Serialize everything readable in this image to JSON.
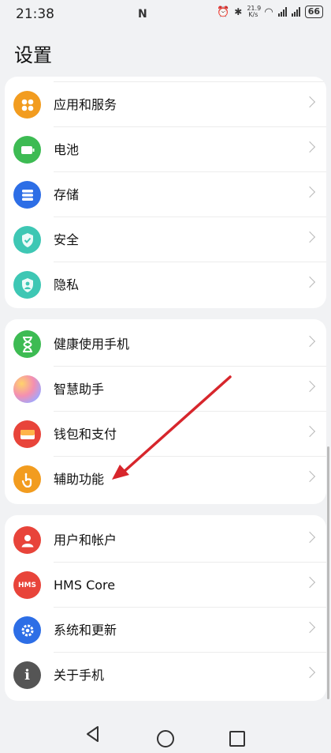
{
  "status_bar": {
    "time": "21:38",
    "nfc": "N",
    "speed_value": "21.9",
    "speed_unit": "K/s",
    "battery": "66"
  },
  "page_title": "设置",
  "group1": [
    {
      "label": "应用和服务",
      "icon": "apps-icon",
      "color": "#f29c1f"
    },
    {
      "label": "电池",
      "icon": "battery-icon",
      "color": "#3dbb53"
    },
    {
      "label": "存储",
      "icon": "storage-icon",
      "color": "#2d6ee6"
    },
    {
      "label": "安全",
      "icon": "shield-icon",
      "color": "#3ec7b4"
    },
    {
      "label": "隐私",
      "icon": "privacy-icon",
      "color": "#3ec7b4"
    }
  ],
  "group2": [
    {
      "label": "健康使用手机",
      "icon": "hourglass-icon",
      "color": "#3dbb53"
    },
    {
      "label": "智慧助手",
      "icon": "assistant-icon",
      "color": "#c98cf0"
    },
    {
      "label": "钱包和支付",
      "icon": "wallet-icon",
      "color": "#e8443a"
    },
    {
      "label": "辅助功能",
      "icon": "accessibility-icon",
      "color": "#f29c1f"
    }
  ],
  "group3": [
    {
      "label": "用户和帐户",
      "icon": "user-icon",
      "color": "#e8443a"
    },
    {
      "label": "HMS Core",
      "icon": "hms-icon",
      "color": "#e8443a",
      "icon_text": "HMS"
    },
    {
      "label": "系统和更新",
      "icon": "system-update-icon",
      "color": "#2d6ee6"
    },
    {
      "label": "关于手机",
      "icon": "info-icon",
      "color": "#555555",
      "icon_text": "i"
    }
  ],
  "colors": {
    "annotation_arrow": "#d7262c"
  }
}
